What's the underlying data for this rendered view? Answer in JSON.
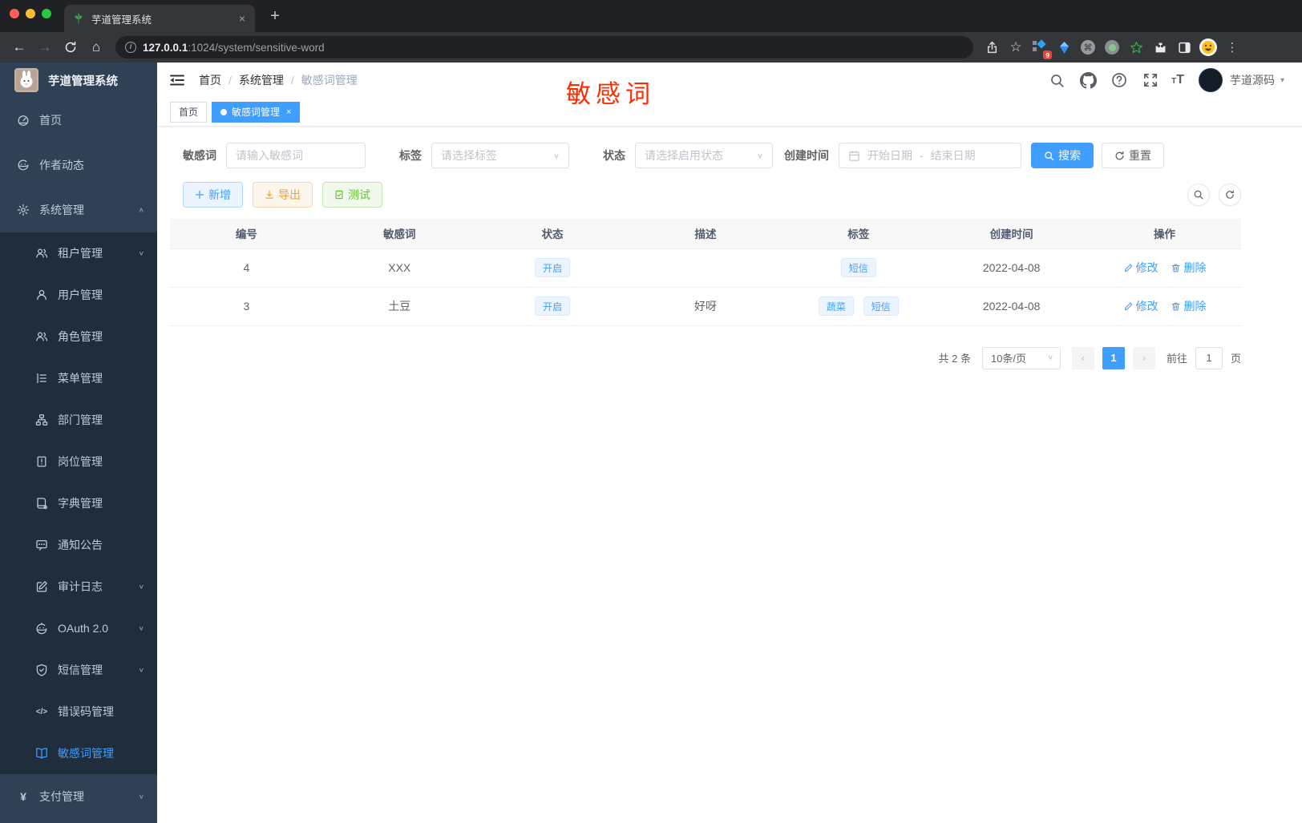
{
  "browser": {
    "tab_title": "芋道管理系统",
    "new_tab_label": "+",
    "url": {
      "host": "127.0.0.1",
      "rest": ":1024/system/sensitive-word"
    },
    "extension_badge": "9"
  },
  "icons": {
    "back": "←",
    "forward": "→",
    "home": "⌂",
    "star": "☆",
    "cmd": "⌘",
    "kebab": "⋮",
    "caret_down": "▾",
    "chevron_down": "∨",
    "chevron_up": "∧",
    "close": "×",
    "prev_arrow": "‹",
    "next_arrow": "›",
    "code_glyph": "</>",
    "yen_glyph": "¥",
    "info": "i"
  },
  "sidebar": {
    "title": "芋道管理系统",
    "items": [
      {
        "label": "首页"
      },
      {
        "label": "作者动态"
      },
      {
        "label": "系统管理"
      },
      {
        "label": "租户管理"
      },
      {
        "label": "用户管理"
      },
      {
        "label": "角色管理"
      },
      {
        "label": "菜单管理"
      },
      {
        "label": "部门管理"
      },
      {
        "label": "岗位管理"
      },
      {
        "label": "字典管理"
      },
      {
        "label": "通知公告"
      },
      {
        "label": "审计日志"
      },
      {
        "label": "OAuth 2.0"
      },
      {
        "label": "短信管理"
      },
      {
        "label": "错误码管理"
      },
      {
        "label": "敏感词管理"
      },
      {
        "label": "支付管理"
      }
    ]
  },
  "header": {
    "breadcrumb": [
      "首页",
      "系统管理",
      "敏感词管理"
    ],
    "separator": "/",
    "username": "芋道源码"
  },
  "annotation": {
    "text": "敏感词"
  },
  "tabs": {
    "home": "首页",
    "active": "敏感词管理"
  },
  "filters": {
    "keyword_label": "敏感词",
    "keyword_placeholder": "请输入敏感词",
    "tag_label": "标签",
    "tag_placeholder": "请选择标签",
    "status_label": "状态",
    "status_placeholder": "请选择启用状态",
    "date_label": "创建时间",
    "date_start_placeholder": "开始日期",
    "date_separator": "-",
    "date_end_placeholder": "结束日期",
    "search_label": "搜索",
    "reset_label": "重置"
  },
  "toolbar": {
    "add_label": "新增",
    "export_label": "导出",
    "test_label": "测试"
  },
  "table": {
    "columns": [
      "编号",
      "敏感词",
      "状态",
      "描述",
      "标签",
      "创建时间",
      "操作"
    ],
    "rows": [
      {
        "id": "4",
        "word": "XXX",
        "status": "开启",
        "description": "",
        "tags": [
          "短信"
        ],
        "created": "2022-04-08",
        "edit": "修改",
        "delete": "删除"
      },
      {
        "id": "3",
        "word": "土豆",
        "status": "开启",
        "description": "好呀",
        "tags": [
          "蔬菜",
          "短信"
        ],
        "created": "2022-04-08",
        "edit": "修改",
        "delete": "删除"
      }
    ]
  },
  "pagination": {
    "total": "共 2 条",
    "page_size": "10条/页",
    "current_page": "1",
    "goto_label": "前往",
    "goto_value": "1",
    "goto_suffix": "页"
  },
  "colors": {
    "primary": "#409eff",
    "menu_bg": "#304156",
    "submenu_bg": "#1f2d3d",
    "annotation": "#ff2b00"
  }
}
